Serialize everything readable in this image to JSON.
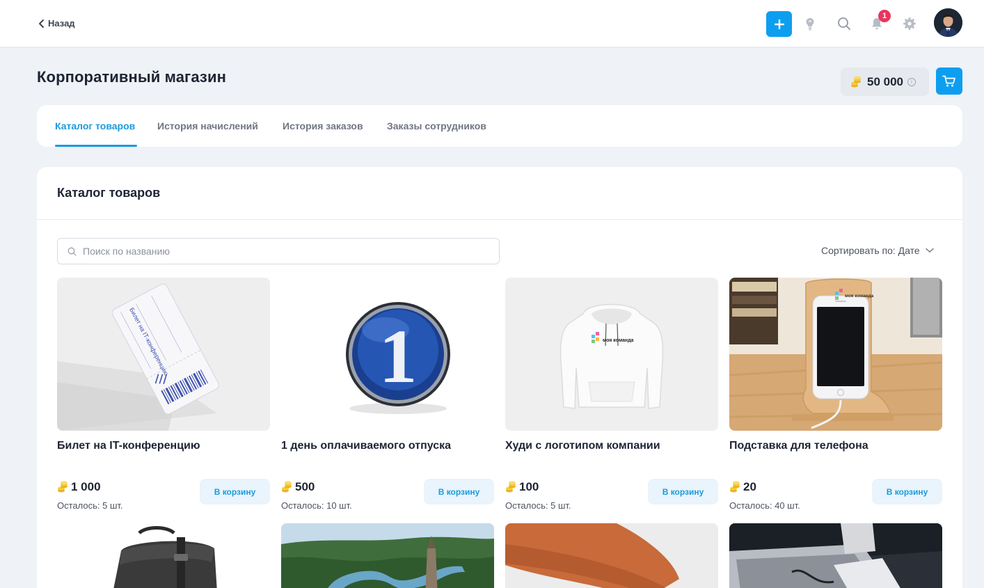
{
  "topbar": {
    "back_label": "Назад",
    "notification_count": "1"
  },
  "header": {
    "title": "Корпоративный магазин",
    "balance": "50 000"
  },
  "tabs": [
    {
      "label": "Каталог товаров",
      "active": true
    },
    {
      "label": "История начислений",
      "active": false
    },
    {
      "label": "История заказов",
      "active": false
    },
    {
      "label": "Заказы сотрудников",
      "active": false
    }
  ],
  "catalog": {
    "title": "Каталог товаров",
    "search_placeholder": "Поиск по названию",
    "sort_label": "Сортировать по: Дате",
    "add_to_cart_label": "В корзину",
    "products": [
      {
        "name": "Билет на IT-конференцию",
        "price": "1 000",
        "stock": "Осталось: 5 шт."
      },
      {
        "name": "1 день оплачиваемого отпуска",
        "price": "500",
        "stock": "Осталось: 10 шт."
      },
      {
        "name": "Худи с логотипом компании",
        "price": "100",
        "stock": "Осталось: 5 шт."
      },
      {
        "name": "Подставка для телефона",
        "price": "20",
        "stock": "Осталось: 40 шт."
      }
    ],
    "product_images": {
      "ticket_lines": [
        "Билет на IT-конференцию"
      ],
      "medal_digit": "1",
      "hoodie_logo": "моя команда",
      "stand_logo": "моя команда"
    }
  },
  "colors": {
    "accent": "#0e9ef0",
    "link": "#1a9bdc",
    "badge": "#e8365d",
    "coin": "#f2c230"
  },
  "icons": {
    "back": "chevron-left-icon",
    "add": "plus-icon",
    "tips": "lightbulb-icon",
    "search": "search-icon",
    "notifications": "bell-icon",
    "settings": "gear-icon",
    "cart": "cart-icon",
    "coin": "coins-icon",
    "info": "info-icon",
    "sort": "chevron-down-icon"
  }
}
